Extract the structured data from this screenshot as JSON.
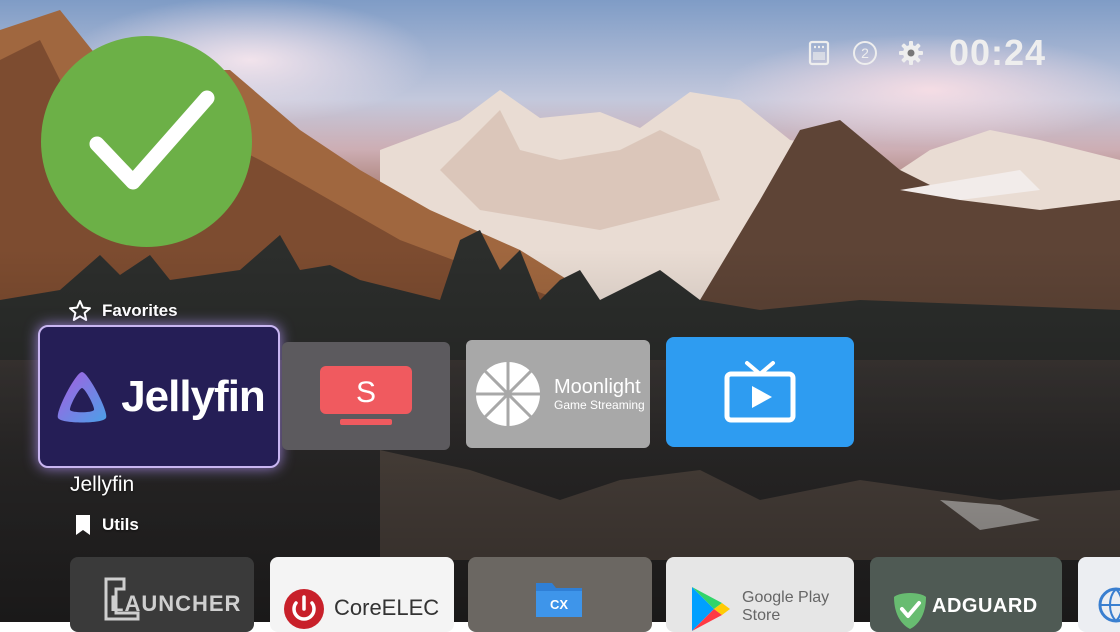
{
  "status_bar": {
    "notification_count": "2",
    "clock": "00:24",
    "icons": [
      "sd-card-icon",
      "notification-badge",
      "gear-icon"
    ]
  },
  "overlay": {
    "icon": "check-icon",
    "color": "#6cb047"
  },
  "favorites": {
    "heading": "Favorites",
    "icon": "star-outline-icon",
    "selected_label": "Jellyfin",
    "tiles": [
      {
        "id": "jellyfin",
        "logo_text": "Jellyfin",
        "color": "#251e56",
        "focused": true
      },
      {
        "id": "s-app",
        "logo_text": "S",
        "color": "#5c5a5e"
      },
      {
        "id": "moonlight",
        "title": "Moonlight",
        "subtitle": "Game Streaming",
        "color": "#a8a8a8"
      },
      {
        "id": "tv",
        "icon": "tv-play-icon",
        "color": "#2e9cf1"
      }
    ]
  },
  "utils": {
    "heading": "Utils",
    "icon": "bookmark-icon",
    "tiles": [
      {
        "id": "launcher",
        "label": "LAUNCHER"
      },
      {
        "id": "coreelec",
        "label": "CoreELEC"
      },
      {
        "id": "cx",
        "label": "CX"
      },
      {
        "id": "google-play",
        "label_line1": "Google Play",
        "label_line2": "Store"
      },
      {
        "id": "adguard",
        "label": "ADGUARD"
      },
      {
        "id": "partial"
      }
    ]
  }
}
